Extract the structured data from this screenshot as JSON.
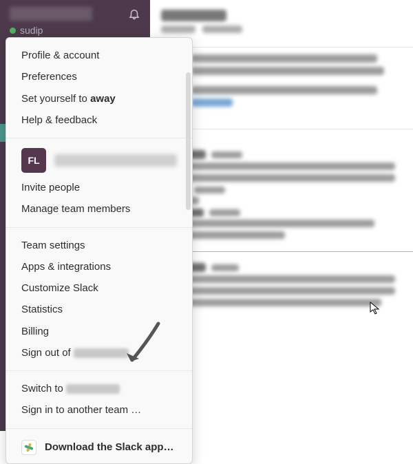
{
  "sidebar": {
    "username": "sudip"
  },
  "menu": {
    "profile": "Profile & account",
    "preferences": "Preferences",
    "set_away_prefix": "Set yourself to ",
    "set_away_bold": "away",
    "help": "Help & feedback",
    "team_badge": "FL",
    "invite": "Invite people",
    "manage": "Manage team members",
    "team_settings": "Team settings",
    "apps": "Apps & integrations",
    "customize": "Customize Slack",
    "statistics": "Statistics",
    "billing": "Billing",
    "sign_out_prefix": "Sign out of ",
    "switch_prefix": "Switch to ",
    "sign_in_another": "Sign in to another team …",
    "download": "Download the Slack app…"
  }
}
